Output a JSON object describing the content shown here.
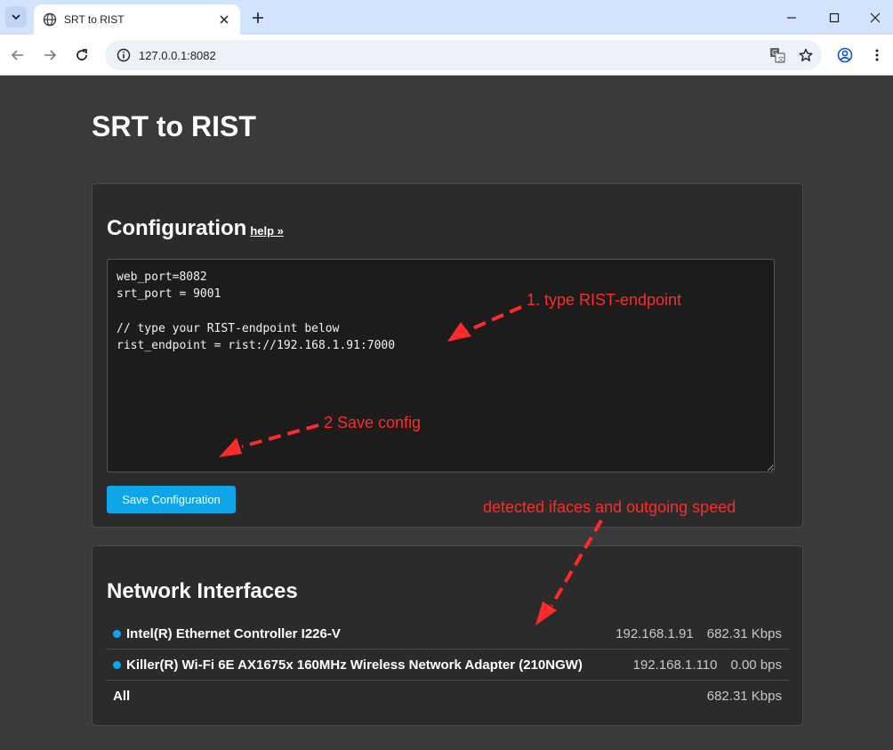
{
  "browser": {
    "tab_title": "SRT to RIST",
    "url": "127.0.0.1:8082"
  },
  "page": {
    "title": "SRT to RIST"
  },
  "config": {
    "heading": "Configuration",
    "help_link": "help »",
    "content": "web_port=8082\nsrt_port = 9001\n\n// type your RIST-endpoint below\nrist_endpoint = rist://192.168.1.91:7000",
    "save_label": "Save Configuration"
  },
  "network": {
    "heading": "Network Interfaces",
    "interfaces": [
      {
        "name": "Intel(R) Ethernet Controller I226-V",
        "ip": "192.168.1.91",
        "speed": "682.31 Kbps"
      },
      {
        "name": "Killer(R) Wi-Fi 6E AX1675x 160MHz Wireless Network Adapter (210NGW)",
        "ip": "192.168.1.110",
        "speed": "0.00 bps"
      }
    ],
    "total": {
      "name": "All",
      "speed": "682.31 Kbps"
    }
  },
  "annotations": {
    "step1": "1. type RIST-endpoint",
    "step2": "2 Save config",
    "ifaces": "detected ifaces and outgoing speed"
  },
  "colors": {
    "accent": "#0ea5e9",
    "annotation": "#ff2b2b",
    "page_bg": "#3a3a3a",
    "card_bg": "#2b2b2b"
  }
}
